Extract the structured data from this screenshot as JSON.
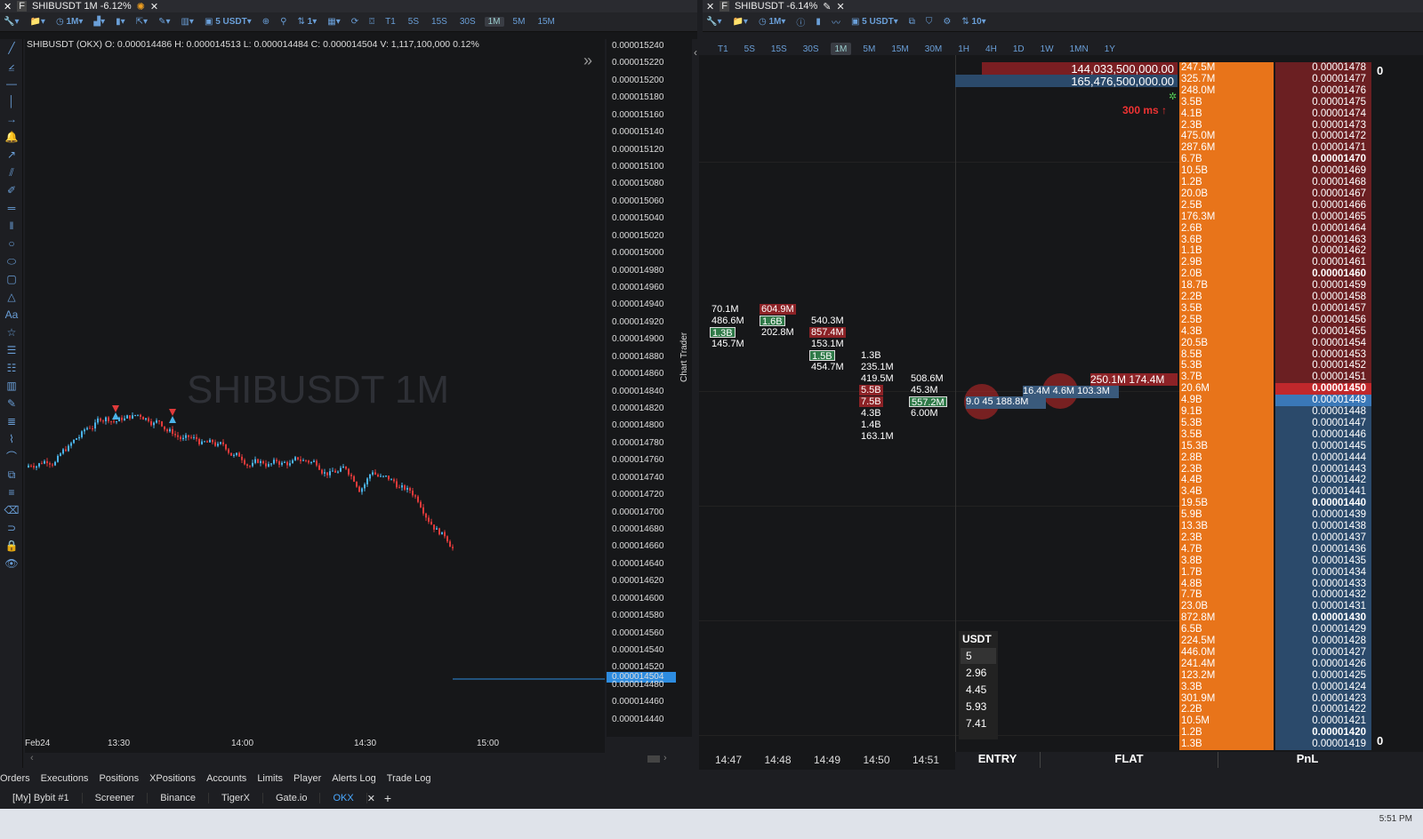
{
  "left_window": {
    "tab_title": "SHIBUSDT 1M -6.12%",
    "toolbar": {
      "timeframe": "1M",
      "size": "5 USDT",
      "count": "1",
      "timeframes": [
        "T1",
        "5S",
        "15S",
        "30S",
        "1M",
        "5M",
        "15M"
      ],
      "active_tf": "1M"
    },
    "ohlc_label": "SHIBUSDT (OKX)  O: 0.000014486 H: 0.000014513 L: 0.000014484 C: 0.000014504 V: 1,117,100,000 0.12%",
    "watermark": "SHIBUSDT 1M",
    "price_labels": [
      "0.000015240",
      "0.000015220",
      "0.000015200",
      "0.000015180",
      "0.000015160",
      "0.000015140",
      "0.000015120",
      "0.000015100",
      "0.000015080",
      "0.000015060",
      "0.000015040",
      "0.000015020",
      "0.000015000",
      "0.000014980",
      "0.000014960",
      "0.000014940",
      "0.000014920",
      "0.000014900",
      "0.000014880",
      "0.000014860",
      "0.000014840",
      "0.000014820",
      "0.000014800",
      "0.000014780",
      "0.000014760",
      "0.000014740",
      "0.000014720",
      "0.000014700",
      "0.000014680",
      "0.000014660",
      "0.000014640",
      "0.000014620",
      "0.000014600",
      "0.000014580",
      "0.000014560",
      "0.000014540",
      "0.000014520",
      "0.000014504",
      "0.000014480",
      "0.000014460",
      "0.000014440"
    ],
    "current_price": "0.000014504",
    "time_labels": [
      "Feb24",
      "13:30",
      "14:00",
      "14:30",
      "15:00"
    ]
  },
  "right_window": {
    "tab_title": "SHIBUSDT -6.14%",
    "toolbar": {
      "timeframe": "1M",
      "size": "5 USDT",
      "count": "10",
      "timeframes": [
        "T1",
        "5S",
        "15S",
        "30S",
        "1M",
        "5M",
        "15M",
        "30M",
        "1H",
        "4H",
        "1D",
        "1W",
        "1MN",
        "1Y"
      ],
      "active_tf": "1M"
    },
    "side_label": "Chart Trader",
    "top_totals": [
      "144,033,500,000.00",
      "165,476,500,000.00"
    ],
    "latency": "300 ms",
    "footprint_times": [
      "14:47",
      "14:48",
      "14:49",
      "14:50",
      "14:51"
    ],
    "footprint_cols": [
      [
        "70.1M",
        "486.6M",
        "1.3B",
        "145.7M"
      ],
      [
        "604.9M",
        "1.6B",
        "202.8M"
      ],
      [
        "540.3M",
        "857.4M",
        "153.1M",
        "1.5B",
        "454.7M"
      ],
      [
        "1.3B",
        "235.1M",
        "419.5M",
        "5.5B",
        "7.5B",
        "4.3B",
        "1.4B",
        "163.1M"
      ],
      [
        "508.6M",
        "45.3M",
        "557.2M",
        "6.00M"
      ]
    ],
    "trades": [
      "9.0",
      "45",
      "188.8M",
      "16.4M",
      "4.6M",
      "103.3M",
      "250.1M",
      "174.4M"
    ],
    "usdt": {
      "label": "USDT",
      "options": [
        "5",
        "2.96",
        "4.45",
        "5.93",
        "7.41"
      ]
    },
    "bottom": {
      "entry": "ENTRY",
      "flat": "FLAT",
      "pnl": "PnL"
    },
    "right_zero_top": "0",
    "right_zero_bottom": "0",
    "dom": [
      [
        "247.5M",
        "0.00001478",
        "ask"
      ],
      [
        "325.7M",
        "0.00001477",
        "ask"
      ],
      [
        "248.0M",
        "0.00001476",
        "ask"
      ],
      [
        "3.5B",
        "0.00001475",
        "ask"
      ],
      [
        "4.1B",
        "0.00001474",
        "ask"
      ],
      [
        "2.3B",
        "0.00001473",
        "ask"
      ],
      [
        "475.0M",
        "0.00001472",
        "ask"
      ],
      [
        "287.6M",
        "0.00001471",
        "ask"
      ],
      [
        "6.7B",
        "0.00001470",
        "ask"
      ],
      [
        "10.5B",
        "0.00001469",
        "ask"
      ],
      [
        "1.2B",
        "0.00001468",
        "ask"
      ],
      [
        "20.0B",
        "0.00001467",
        "ask"
      ],
      [
        "2.5B",
        "0.00001466",
        "ask"
      ],
      [
        "176.3M",
        "0.00001465",
        "ask"
      ],
      [
        "2.6B",
        "0.00001464",
        "ask"
      ],
      [
        "3.6B",
        "0.00001463",
        "ask"
      ],
      [
        "1.1B",
        "0.00001462",
        "ask"
      ],
      [
        "2.9B",
        "0.00001461",
        "ask"
      ],
      [
        "2.0B",
        "0.00001460",
        "ask"
      ],
      [
        "18.7B",
        "0.00001459",
        "ask"
      ],
      [
        "2.2B",
        "0.00001458",
        "ask"
      ],
      [
        "3.5B",
        "0.00001457",
        "ask"
      ],
      [
        "2.5B",
        "0.00001456",
        "ask"
      ],
      [
        "4.3B",
        "0.00001455",
        "ask"
      ],
      [
        "20.5B",
        "0.00001454",
        "ask"
      ],
      [
        "8.5B",
        "0.00001453",
        "ask"
      ],
      [
        "5.3B",
        "0.00001452",
        "ask"
      ],
      [
        "3.7B",
        "0.00001451",
        "ask"
      ],
      [
        "20.6M",
        "0.00001450",
        "ask"
      ],
      [
        "4.9B",
        "0.00001449",
        "bid"
      ],
      [
        "9.1B",
        "0.00001448",
        "bid"
      ],
      [
        "5.3B",
        "0.00001447",
        "bid"
      ],
      [
        "3.5B",
        "0.00001446",
        "bid"
      ],
      [
        "15.3B",
        "0.00001445",
        "bid"
      ],
      [
        "2.8B",
        "0.00001444",
        "bid"
      ],
      [
        "2.3B",
        "0.00001443",
        "bid"
      ],
      [
        "4.4B",
        "0.00001442",
        "bid"
      ],
      [
        "3.4B",
        "0.00001441",
        "bid"
      ],
      [
        "19.5B",
        "0.00001440",
        "bid"
      ],
      [
        "5.9B",
        "0.00001439",
        "bid"
      ],
      [
        "13.3B",
        "0.00001438",
        "bid"
      ],
      [
        "2.3B",
        "0.00001437",
        "bid"
      ],
      [
        "4.7B",
        "0.00001436",
        "bid"
      ],
      [
        "3.8B",
        "0.00001435",
        "bid"
      ],
      [
        "1.7B",
        "0.00001434",
        "bid"
      ],
      [
        "4.8B",
        "0.00001433",
        "bid"
      ],
      [
        "7.7B",
        "0.00001432",
        "bid"
      ],
      [
        "23.0B",
        "0.00001431",
        "bid"
      ],
      [
        "872.8M",
        "0.00001430",
        "bid"
      ],
      [
        "6.5B",
        "0.00001429",
        "bid"
      ],
      [
        "224.5M",
        "0.00001428",
        "bid"
      ],
      [
        "446.0M",
        "0.00001427",
        "bid"
      ],
      [
        "241.4M",
        "0.00001426",
        "bid"
      ],
      [
        "123.2M",
        "0.00001425",
        "bid"
      ],
      [
        "3.3B",
        "0.00001424",
        "bid"
      ],
      [
        "301.9M",
        "0.00001423",
        "bid"
      ],
      [
        "2.2B",
        "0.00001422",
        "bid"
      ],
      [
        "10.5M",
        "0.00001421",
        "bid"
      ],
      [
        "1.2B",
        "0.00001420",
        "bid"
      ],
      [
        "1.3B",
        "0.00001419",
        "bid"
      ]
    ]
  },
  "bottom_tabs": [
    "Orders",
    "Executions",
    "Positions",
    "XPositions",
    "Accounts",
    "Limits",
    "Player",
    "Alerts Log",
    "Trade Log"
  ],
  "workspace_tabs": [
    "[My] Bybit #1",
    "Screener",
    "Binance",
    "TigerX",
    "Gate.io",
    "OKX"
  ],
  "active_workspace": "OKX",
  "clock": "5:51 PM",
  "colors": {
    "up": "#4ab3e8",
    "down": "#e03a3a",
    "accent": "#4aa8ff",
    "ask": "#6b1f22",
    "bid": "#2b4a6b",
    "dom_vol": "#e8741a"
  }
}
